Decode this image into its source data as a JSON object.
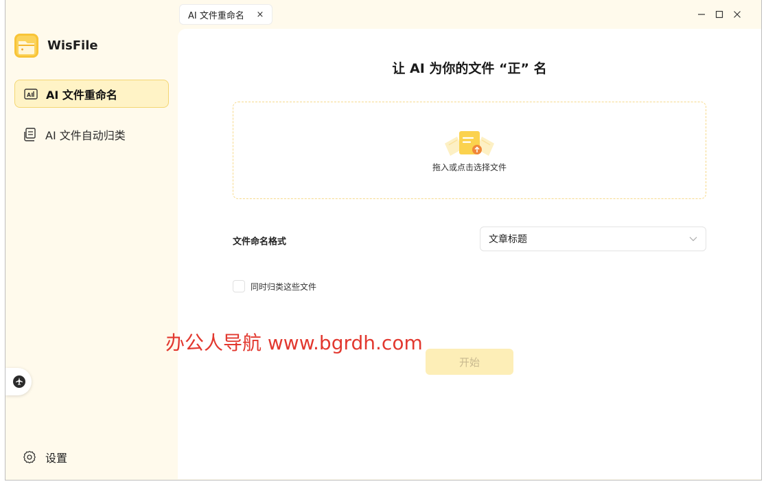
{
  "titlebar": {
    "tab_label": "AI 文件重命名",
    "tab_close": "×"
  },
  "sidebar": {
    "app_name": "WisFile",
    "items": [
      {
        "label": "AI 文件重命名",
        "icon": "ai-rename-icon",
        "active": true
      },
      {
        "label": "AI 文件自动归类",
        "icon": "ai-classify-icon",
        "active": false
      }
    ],
    "settings_label": "设置"
  },
  "main": {
    "heading": "让 AI 为你的文件 “正” 名",
    "dropzone_text": "拖入或点击选择文件",
    "format_label": "文件命名格式",
    "format_value": "文章标题",
    "checkbox_label": "同时归类这些文件",
    "checkbox_checked": false,
    "start_label": "开始"
  },
  "watermark": "办公人导航  www.bgrdh.com",
  "colors": {
    "sidebar_bg": "#fffaec",
    "active_item_bg": "#fff3c6",
    "active_item_border": "#f3d672",
    "dropzone_border": "#f7d98a",
    "start_button_bg": "#fdeeb7",
    "watermark": "#e2382f"
  }
}
